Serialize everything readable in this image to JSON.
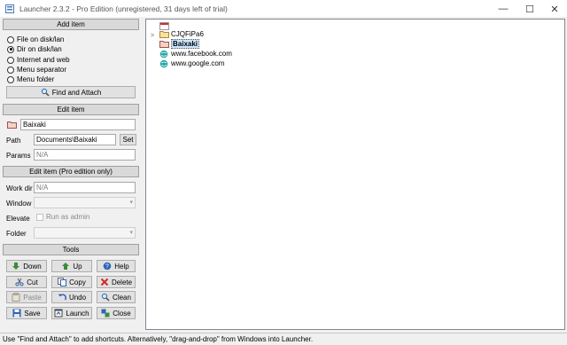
{
  "window": {
    "title": "Launcher 2.3.2 - Pro Edition (unregistered, 31 days left of trial)",
    "controls": {
      "minimize": "—",
      "maximize": "☐",
      "close": "✕"
    }
  },
  "add_item": {
    "header": "Add item",
    "options": [
      {
        "label": "File on disk/lan",
        "checked": false
      },
      {
        "label": "Dir on disk/lan",
        "checked": true
      },
      {
        "label": "Internet and web",
        "checked": false
      },
      {
        "label": "Menu separator",
        "checked": false
      },
      {
        "label": "Menu folder",
        "checked": false
      }
    ],
    "find_button": "Find and Attach"
  },
  "edit_item": {
    "header": "Edit item",
    "name_value": "Baixaki",
    "path_label": "Path",
    "path_value": "Documents\\Baixaki",
    "set_button": "Set",
    "params_label": "Params",
    "params_placeholder": "N/A"
  },
  "edit_pro": {
    "header": "Edit item (Pro edition only)",
    "workdir_label": "Work dir",
    "workdir_placeholder": "N/A",
    "window_label": "Window",
    "window_value": "",
    "elevate_label": "Elevate",
    "run_as_admin": "Run as admin",
    "folder_label": "Folder",
    "folder_value": ""
  },
  "tools": {
    "header": "Tools",
    "buttons": [
      {
        "label": "Down",
        "icon": "arrow-down-icon",
        "disabled": false
      },
      {
        "label": "Up",
        "icon": "arrow-up-icon",
        "disabled": false
      },
      {
        "label": "Help",
        "icon": "help-icon",
        "disabled": false
      },
      {
        "label": "Cut",
        "icon": "scissors-icon",
        "disabled": false
      },
      {
        "label": "Copy",
        "icon": "copy-icon",
        "disabled": false
      },
      {
        "label": "Delete",
        "icon": "delete-x-icon",
        "disabled": false
      },
      {
        "label": "Paste",
        "icon": "paste-icon",
        "disabled": true
      },
      {
        "label": "Undo",
        "icon": "undo-icon",
        "disabled": false
      },
      {
        "label": "Clean",
        "icon": "magnifier-icon",
        "disabled": false
      },
      {
        "label": "Save",
        "icon": "floppy-icon",
        "disabled": false
      },
      {
        "label": "Launch",
        "icon": "launch-icon",
        "disabled": false
      },
      {
        "label": "Close",
        "icon": "close-window-icon",
        "disabled": false
      }
    ]
  },
  "tree": {
    "expander": ">",
    "items": [
      {
        "label": "",
        "icon": "menu-strip-icon",
        "selected": false
      },
      {
        "label": "CJQFiPa6",
        "icon": "folder-icon",
        "selected": false
      },
      {
        "label": "Baixaki",
        "icon": "folder-selected-icon",
        "selected": true
      },
      {
        "label": "www.facebook.com",
        "icon": "web-link-icon",
        "selected": false
      },
      {
        "label": "www.google.com",
        "icon": "web-link-icon",
        "selected": false
      }
    ]
  },
  "status_bar": "Use \"Find and Attach\" to add shortcuts. Alternatively, \"drag-and-drop\" from Windows into Launcher.",
  "colors": {
    "selection": "#cce8ff",
    "header": "#d9d9d9",
    "face": "#f0f0f0"
  }
}
